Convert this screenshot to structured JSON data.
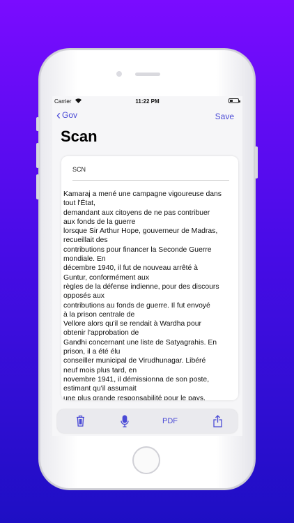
{
  "status_bar": {
    "carrier": "Carrier",
    "time": "11:22 PM"
  },
  "nav": {
    "back_label": "Gov",
    "save_label": "Save"
  },
  "page": {
    "title": "Scan"
  },
  "document": {
    "name": "SCN",
    "lines": [
      "Kamaraj a mené une campagne vigoureuse dans",
      "tout l'État,",
      "demandant aux citoyens de ne pas contribuer",
      "aux fonds de la guerre",
      "lorsque Sir Arthur Hope, gouverneur de Madras,",
      "recueillait des",
      "contributions pour financer la Seconde Guerre",
      "mondiale. En",
      "décembre 1940, il fut de nouveau arrêté à",
      "Guntur, conformément aux",
      "règles de la défense indienne, pour des discours",
      "opposés aux",
      "contributions au fonds de guerre. Il fut envoyé",
      "à la prison centrale de",
      "Vellore alors qu'il se rendait à Wardha pour",
      "obtenir l'approbation de",
      "Gandhi concernant une liste de Satyagrahis. En",
      "prison, il a été élu",
      "conseiller municipal de Virudhunagar. Libéré",
      "neuf mois plus tard, en",
      "novembre 1941, il démissionna de son poste,",
      "estimant qu'il assumait",
      "une plus grande responsabilité pour le pays."
    ]
  },
  "toolbar": {
    "pdf_label": "PDF",
    "icons": [
      "trash-icon",
      "microphone-icon",
      "share-icon"
    ]
  },
  "colors": {
    "accent": "#4a4ad6",
    "background_top": "#7a0cff",
    "background_bottom": "#1e0fc4"
  }
}
